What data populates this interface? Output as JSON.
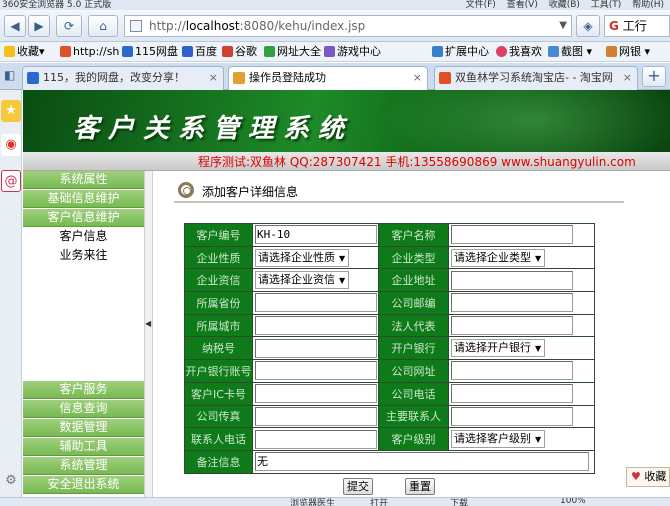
{
  "browser": {
    "window_title": "360安全浏览器 5.0 正式版",
    "menu": [
      "文件(F)",
      "查看(V)",
      "收藏(B)",
      "工具(T)",
      "帮助(H)"
    ],
    "nav": {
      "back": "◀",
      "forward": "▶",
      "refresh": "⟳",
      "home": "⌂"
    },
    "url_prefix": "http://",
    "url_host": "localhost",
    "url_path": ":8080/kehu/index.jsp",
    "search_text": "工行",
    "favorites": [
      "收藏",
      "http://sh",
      "115网盘",
      "百度",
      "谷歌",
      "网址大全",
      "游戏中心",
      "扩展中心",
      "我喜欢",
      "截图",
      "网银"
    ],
    "tabs": [
      {
        "label": "115，我的网盘，改变分享！"
      },
      {
        "label": "操作员登陆成功"
      },
      {
        "label": "双鱼林学习系统淘宝店- - 淘宝网"
      }
    ],
    "new_tab": "+",
    "favorite_button": "收藏",
    "status_items": [
      "浏览器医生",
      "打开",
      "下载",
      "100%"
    ]
  },
  "app": {
    "title": "客户关系管理系统",
    "contact": "程序测试:双鱼林 QQ:287307421 手机:13558690869 www.shuangyulin.com",
    "menu_top": [
      {
        "label": "系统属性"
      },
      {
        "label": "基础信息维护"
      },
      {
        "label": "客户信息维护"
      }
    ],
    "submenu": [
      {
        "label": "客户信息"
      },
      {
        "label": "业务来往"
      }
    ],
    "menu_bottom": [
      {
        "label": "客户服务"
      },
      {
        "label": "信息查询"
      },
      {
        "label": "数据管理"
      },
      {
        "label": "辅助工具"
      },
      {
        "label": "系统管理"
      },
      {
        "label": "安全退出系统"
      }
    ],
    "collapse_arrow": "◀",
    "page_heading": "添加客户详细信息",
    "form": {
      "customer_no_label": "客户编号",
      "customer_no_value": "KH-10",
      "customer_name_label": "客户名称",
      "customer_name_value": "",
      "nature_label": "企业性质",
      "nature_value": "请选择企业性质",
      "type_label": "企业类型",
      "type_value": "请选择企业类型",
      "credit_label": "企业资信",
      "credit_value": "请选择企业资信",
      "address_label": "企业地址",
      "address_value": "",
      "province_label": "所属省份",
      "province_value": "",
      "postcode_label": "公司邮编",
      "postcode_value": "",
      "city_label": "所属城市",
      "city_value": "",
      "legal_label": "法人代表",
      "legal_value": "",
      "tax_label": "纳税号",
      "tax_value": "",
      "bank_label": "开户银行",
      "bank_value": "请选择开户银行",
      "account_label": "开户银行账号",
      "account_value": "",
      "website_label": "公司网址",
      "website_value": "",
      "ic_label": "客户IC卡号",
      "ic_value": "",
      "phone_label": "公司电话",
      "phone_value": "",
      "fax_label": "公司传真",
      "fax_value": "",
      "contact_label": "主要联系人",
      "contact_value": "",
      "contact_phone_label": "联系人电话",
      "contact_phone_value": "",
      "level_label": "客户级别",
      "level_value": "请选择客户级别",
      "remark_label": "备注信息",
      "remark_value": "无"
    },
    "submit_label": "提交",
    "reset_label": "重置"
  }
}
